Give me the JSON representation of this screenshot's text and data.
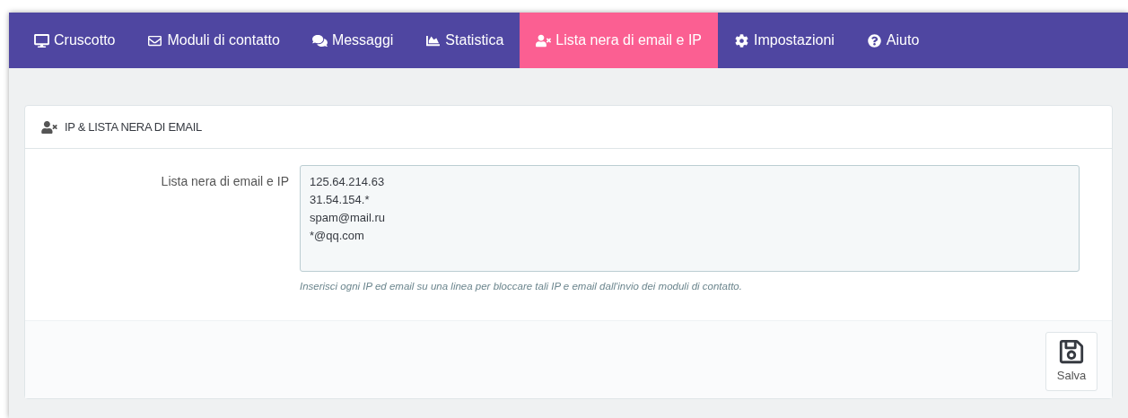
{
  "tabs": [
    {
      "label": "Cruscotto",
      "selected": false
    },
    {
      "label": "Moduli di contatto",
      "selected": false
    },
    {
      "label": "Messaggi",
      "selected": false
    },
    {
      "label": "Statistica",
      "selected": false
    },
    {
      "label": "Lista nera di email e IP",
      "selected": true
    },
    {
      "label": "Impostazioni",
      "selected": false
    },
    {
      "label": "Aiuto",
      "selected": false
    }
  ],
  "panel": {
    "title": "IP & LISTA NERA DI EMAIL",
    "field": {
      "label": "Lista nera di email e IP",
      "value": [
        "125.64.214.63",
        "31.54.154.*",
        "spam@mail.ru",
        "*@qq.com"
      ],
      "help": "Inserisci ogni IP ed email su una linea per bloccare tali IP e email dall'invio dei moduli di contatto."
    },
    "save_button": "Salva"
  }
}
